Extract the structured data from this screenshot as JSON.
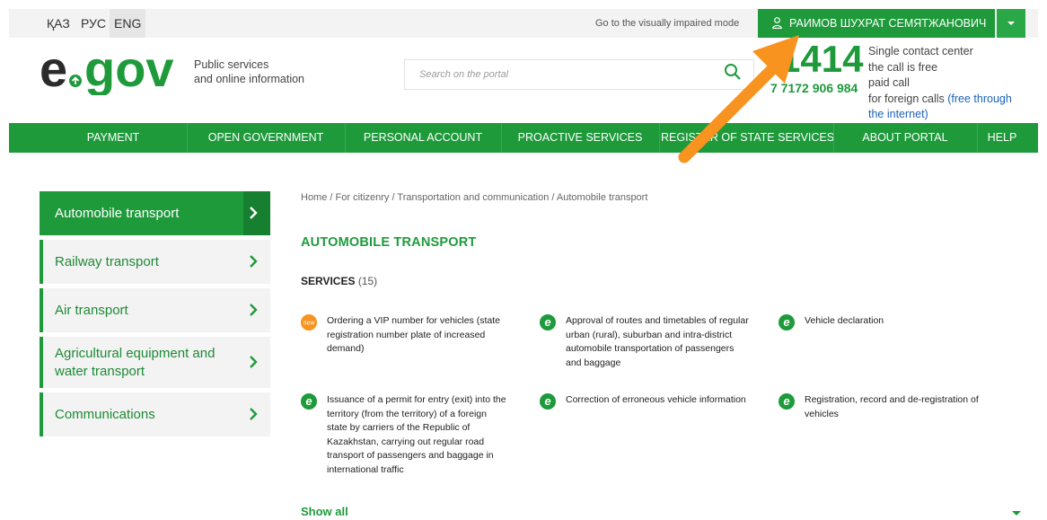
{
  "topbar": {
    "languages": [
      "ҚАЗ",
      "РУС",
      "ENG"
    ],
    "vi_mode": "Go to the visually impaired mode",
    "user_name": "РАИМОВ ШУХРАТ СЕМЯТЖАНОВИЧ"
  },
  "header": {
    "logo_text": "egov",
    "tagline_1": "Public services",
    "tagline_2": "and online information",
    "search_placeholder": "Search on the portal",
    "phone_main": "1414",
    "phone_alt": "7 7172 906 984",
    "contact_1": "Single contact center",
    "contact_2": "the call is free",
    "contact_3": "paid call",
    "contact_4": "for foreign calls ",
    "contact_4_link": "(free through",
    "contact_5_link": "the internet)"
  },
  "nav": {
    "items": [
      "PAYMENT",
      "OPEN GOVERNMENT",
      "PERSONAL ACCOUNT",
      "PROACTIVE SERVICES",
      "REGISTER OF STATE SERVICES",
      "ABOUT PORTAL",
      "HELP"
    ]
  },
  "sidebar": {
    "items": [
      {
        "label_1": "Automobile transport",
        "label_2": ""
      },
      {
        "label_1": "Railway transport",
        "label_2": ""
      },
      {
        "label_1": "Air transport",
        "label_2": ""
      },
      {
        "label_1": "Agricultural equipment and",
        "label_2": "water transport"
      },
      {
        "label_1": "Communications",
        "label_2": ""
      }
    ]
  },
  "main": {
    "breadcrumb": "Home / For citizenry / Transportation and communication / Automobile transport",
    "title": "AUTOMOBILE TRANSPORT",
    "services_label": "SERVICES",
    "services_count": "(15)",
    "badge_new": "new",
    "services": [
      {
        "lines": [
          "Ordering a VIP number for vehicles (state",
          "registration number plate of increased",
          "demand)"
        ],
        "icon": "new-badge-icon"
      },
      {
        "lines": [
          "Approval of routes and timetables of regular",
          "urban (rural), suburban and intra-district",
          "automobile transportation of passengers",
          "and baggage"
        ],
        "icon": "egov-e-icon"
      },
      {
        "lines": [
          "Vehicle declaration"
        ],
        "icon": "egov-e-icon"
      },
      {
        "lines": [
          "Issuance of a permit for entry (exit) into the",
          "territory (from the territory) of a foreign",
          "state by carriers of the Republic of",
          "Kazakhstan, carrying out regular road",
          "transport of passengers and baggage in",
          "international traffic"
        ],
        "icon": "egov-e-icon"
      },
      {
        "lines": [
          "Correction of erroneous vehicle information"
        ],
        "icon": "egov-e-icon"
      },
      {
        "lines": [
          "Registration, record and de-registration of",
          "vehicles"
        ],
        "icon": "egov-e-icon"
      }
    ],
    "show_all": "Show all"
  },
  "colors": {
    "brand_green": "#1e9a3b",
    "accent_orange": "#f7931e",
    "link_blue": "#1a63b8"
  }
}
